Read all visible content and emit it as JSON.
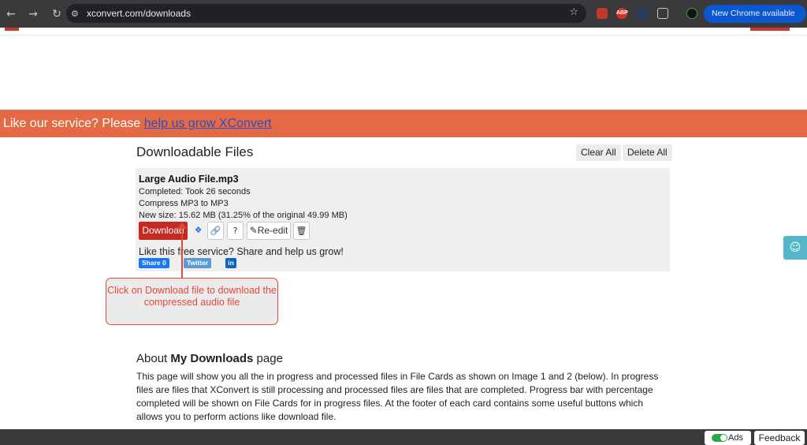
{
  "browser": {
    "url": "xconvert.com/downloads",
    "chrome_update_label": "New Chrome available",
    "back_glyph": "←",
    "forward_glyph": "→",
    "reload_glyph": "↻",
    "tune_glyph": "⚙",
    "star_glyph": "☆",
    "ext_abp_label": "ABP"
  },
  "banner": {
    "text": "Like our service? Please ",
    "link_text": "help us grow XConvert"
  },
  "files": {
    "title": "Downloadable Files",
    "clear_all_label": "Clear All",
    "delete_all_label": "Delete All"
  },
  "card": {
    "file_name": "Large Audio File.mp3",
    "status": "Completed: Took 26 seconds",
    "operation": "Compress MP3 to MP3",
    "new_size": "New size: 15.62 MB (31.25% of the original 49.99 MB)",
    "download_label": "Download",
    "reedit_label": "Re-edit",
    "share_text": "Like this free service? Share and help us grow!",
    "fb_share_label": "Share 0",
    "twitter_label": "Twitter",
    "linkedin_label": "in",
    "dropbox_glyph": "❖",
    "link_glyph": "🔗",
    "help_glyph": "?",
    "edit_glyph": "✎",
    "trash_glyph": "🗑"
  },
  "callout": {
    "text": "Click on Download file to download the compressed audio file"
  },
  "about": {
    "heading_prefix": "About ",
    "heading_bold": "My Downloads",
    "heading_suffix": " page",
    "paragraph": "This page will show you all the in progress and processed files in File Cards as shown on Image 1 and 2 (below). In progress files are files that XConvert is still processing and processed files are files that are completed. Progress bar with percentage completed will be shown on File Cards for in progress files. At the footer of each card contains some useful buttons which allows you to perform actions like download file."
  },
  "footer": {
    "ads_label": "Ads",
    "feedback_label": "Feedback"
  },
  "help_widget": {
    "glyph": "☺"
  },
  "colors": {
    "banner": "#e36a44",
    "download": "#c42a22",
    "callout_border": "#e04a3a",
    "chrome_pill": "#0b57d0"
  }
}
